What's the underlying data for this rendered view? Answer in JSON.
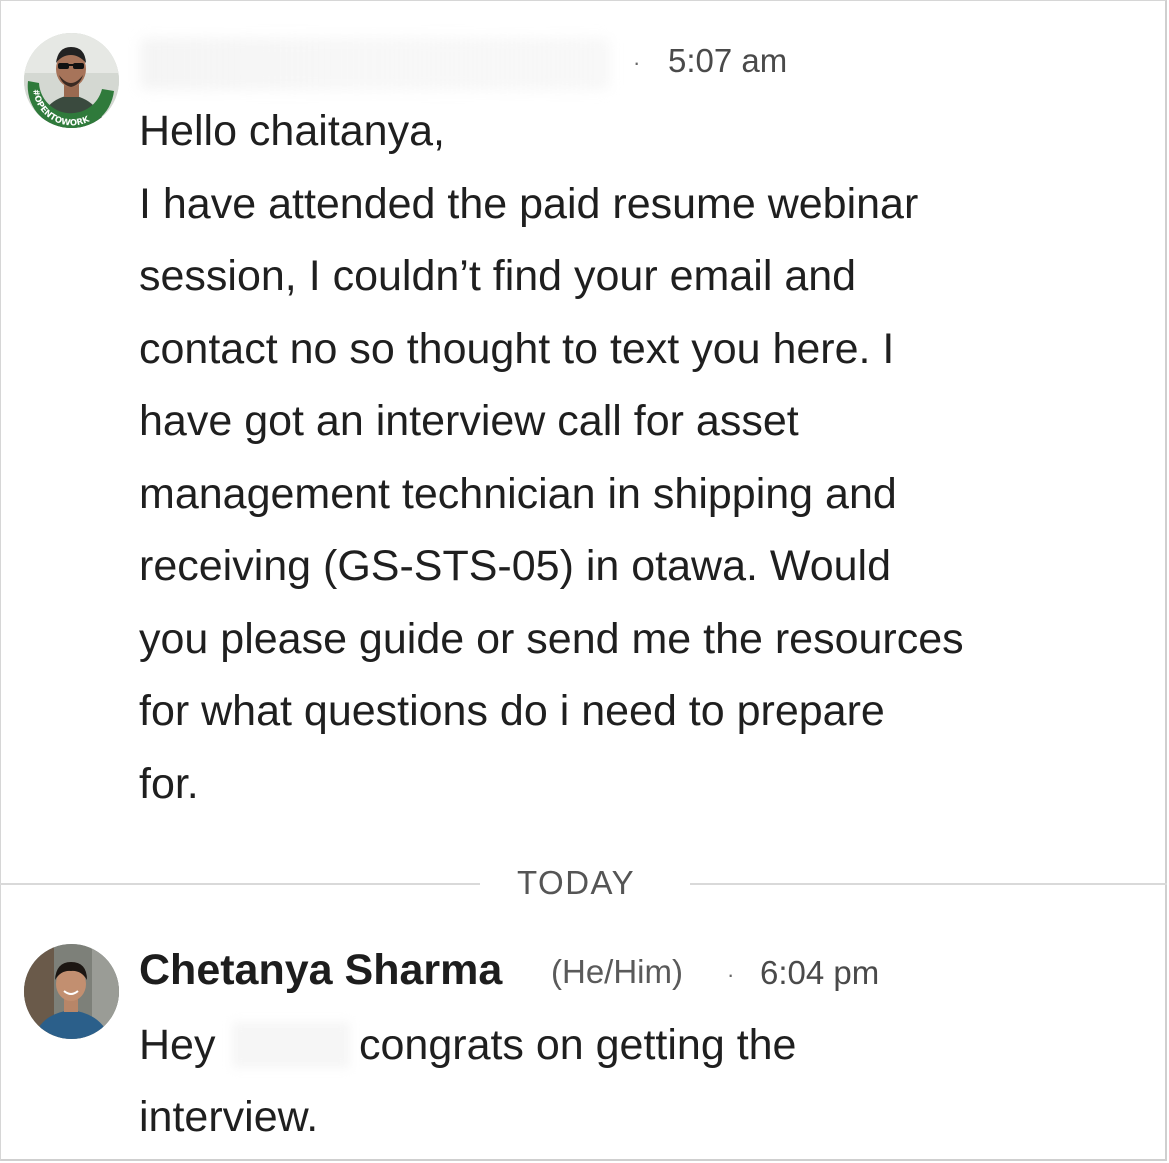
{
  "messages": [
    {
      "time": "5:07 am",
      "separator": "·",
      "avatar_badge": "#OPENTOWORK",
      "lines": [
        "Hello chaitanya,",
        "I have attended the paid resume webinar",
        "session, I couldn’t find your email and",
        "contact no so thought to text you here. I",
        "have got an interview call for asset",
        "management technician in shipping and",
        "receiving (GS-STS-05) in otawa. Would",
        "you please guide or send me the resources",
        "for what questions do i need to prepare",
        "for."
      ]
    },
    {
      "sender": "Chetanya Sharma",
      "pronouns": "(He/Him)",
      "separator": "·",
      "time": "6:04 pm",
      "line1_start": "Hey",
      "line1_end": "congrats on getting the",
      "line2": "interview."
    }
  ],
  "divider": {
    "label": "TODAY"
  },
  "colors": {
    "text": "#1f1f1f",
    "meta": "#4a4a4a",
    "divider": "#d9d9d9",
    "badge_green": "#2f7a3b"
  },
  "icons": {
    "avatar_1": "profile-photo-with-opentowork-frame",
    "avatar_2": "profile-photo"
  }
}
